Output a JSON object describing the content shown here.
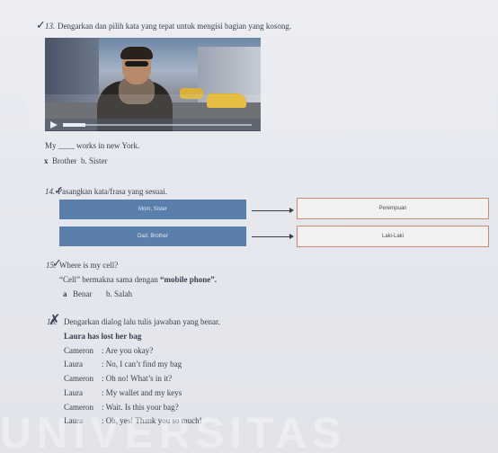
{
  "q13": {
    "number": "13.",
    "instruction": "Dengarkan dan pilih kata yang tepat untuk mengisi bagian yang kosong.",
    "sentence": "My ____ works in new York.",
    "option_a_mark": "x",
    "option_a": "Brother",
    "option_b": "b. Sister",
    "video": {
      "progress_fraction": 0.12
    }
  },
  "q14": {
    "number": "14.",
    "instruction": "Pasangkan kata/frasa yang sesuai.",
    "left_boxes": [
      "Mom, Sister",
      "Dad, Brother"
    ],
    "right_boxes": [
      "Perempuan",
      "Laki-Laki"
    ]
  },
  "q15": {
    "number": "15.",
    "question": "Where is my cell?",
    "statement_prefix": "“Cell” bermakna sama dengan ",
    "statement_bold": "“mobile phone”.",
    "option_a_mark": "a",
    "option_a": "Benar",
    "option_b": "b. Salah"
  },
  "q16": {
    "number": "16.",
    "instruction": "Dengarkan dialog lalu tulis jawaban yang benar.",
    "title": "Laura has lost her bag",
    "dialog": [
      {
        "speaker": "Cameron",
        "line": ": Are you okay?"
      },
      {
        "speaker": "Laura",
        "line": ": No, I can’t find my bag"
      },
      {
        "speaker": "Cameron",
        "line": ": Oh no! What’s in it?"
      },
      {
        "speaker": "Laura",
        "line": ": My wallet and my keys"
      },
      {
        "speaker": "Cameron",
        "line": ": Wait. Is this your bag?"
      },
      {
        "speaker": "Laura",
        "line": ": Oh, yes! Thank you so much!"
      }
    ]
  },
  "watermark": "UNIVERSITAS"
}
